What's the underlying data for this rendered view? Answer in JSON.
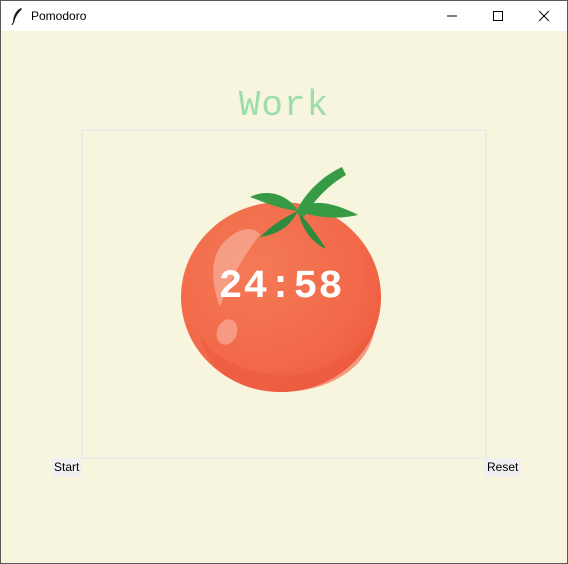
{
  "window": {
    "title": "Pomodoro",
    "controls": {
      "minimize": "minimize-icon",
      "maximize": "maximize-icon",
      "close": "close-icon"
    }
  },
  "main": {
    "mode_label": "Work",
    "timer": "24:58",
    "tomato_image": "tomato-icon"
  },
  "buttons": {
    "start_label": "Start",
    "reset_label": "Reset"
  },
  "colors": {
    "background": "#f7f5dd",
    "mode_label": "#9bdeac",
    "tomato": "#f26849",
    "leaves": "#379b46",
    "timer_text": "#ffffff"
  }
}
